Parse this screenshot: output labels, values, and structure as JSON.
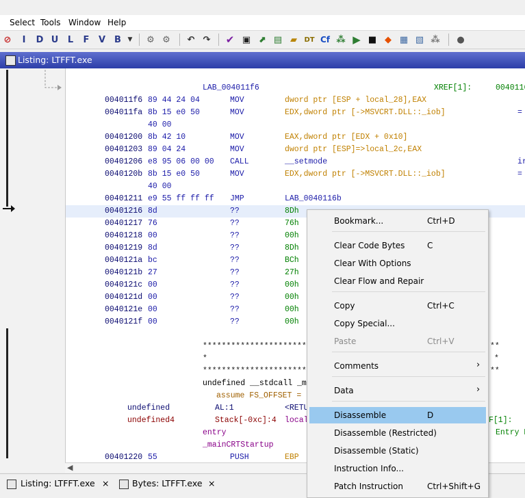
{
  "menu": [
    "Select",
    "Tools",
    "Window",
    "Help"
  ],
  "toolbar": {
    "letters": [
      "I",
      "D",
      "U",
      "L",
      "F",
      "V",
      "B"
    ]
  },
  "window_title": "Listing:  LTFFT.exe",
  "listing": {
    "label_line": {
      "label": "LAB_004011f6",
      "xref": "XREF[1]:",
      "xref_addr": "0040116"
    },
    "rows": [
      {
        "addr": "004011f6",
        "bytes": "89 44 24 04",
        "mn": "MOV",
        "op": "dword ptr [ESP + local_28],EAX",
        "extra": ""
      },
      {
        "addr": "004011fa",
        "bytes": "8b 15 e0 50",
        "mn": "MOV",
        "op": "EDX,dword ptr [->MSVCRT.DLL::_iob]",
        "extra": "="
      },
      {
        "addr": "",
        "bytes": "40 00",
        "mn": "",
        "op": "",
        "extra": ""
      },
      {
        "addr": "00401200",
        "bytes": "8b 42 10",
        "mn": "MOV",
        "op": "EAX,dword ptr [EDX + 0x10]",
        "extra": ""
      },
      {
        "addr": "00401203",
        "bytes": "89 04 24",
        "mn": "MOV",
        "op": "dword ptr [ESP]=>local_2c,EAX",
        "extra": ""
      },
      {
        "addr": "00401206",
        "bytes": "e8 95 06 00 00",
        "mn": "CALL",
        "op": "__setmode",
        "extra": "ir"
      },
      {
        "addr": "0040120b",
        "bytes": "8b 15 e0 50",
        "mn": "MOV",
        "op": "EDX,dword ptr [->MSVCRT.DLL::_iob]",
        "extra": "="
      },
      {
        "addr": "",
        "bytes": "40 00",
        "mn": "",
        "op": "",
        "extra": ""
      },
      {
        "addr": "00401211",
        "bytes": "e9 55 ff ff ff",
        "mn": "JMP",
        "op": "LAB_0040116b",
        "extra": ""
      },
      {
        "addr": "00401216",
        "bytes": "8d",
        "mn": "??",
        "op": "8Dh",
        "extra": ""
      },
      {
        "addr": "00401217",
        "bytes": "76",
        "mn": "??",
        "op": "76h",
        "extra": ""
      },
      {
        "addr": "00401218",
        "bytes": "00",
        "mn": "??",
        "op": "00h",
        "extra": ""
      },
      {
        "addr": "00401219",
        "bytes": "8d",
        "mn": "??",
        "op": "8Dh",
        "extra": ""
      },
      {
        "addr": "0040121a",
        "bytes": "bc",
        "mn": "??",
        "op": "BCh",
        "extra": ""
      },
      {
        "addr": "0040121b",
        "bytes": "27",
        "mn": "??",
        "op": "27h",
        "extra": ""
      },
      {
        "addr": "0040121c",
        "bytes": "00",
        "mn": "??",
        "op": "00h",
        "extra": ""
      },
      {
        "addr": "0040121d",
        "bytes": "00",
        "mn": "??",
        "op": "00h",
        "extra": ""
      },
      {
        "addr": "0040121e",
        "bytes": "00",
        "mn": "??",
        "op": "00h",
        "extra": ""
      },
      {
        "addr": "0040121f",
        "bytes": "00",
        "mn": "??",
        "op": "00h",
        "extra": ""
      }
    ],
    "stars_line": "*****************************************************",
    "star_single": "*",
    "stars_right_a": "**",
    "stars_right_b": "*",
    "stars_right_c": "**",
    "func_sig": "undefined __stdcall _m",
    "assume": "assume FS_OFFSET =",
    "vars": [
      {
        "type": "undefined",
        "loc": "AL:1",
        "name": "<RETU",
        "xref": ""
      },
      {
        "type": "undefined4",
        "loc": "Stack[-0xc]:4",
        "name": "local",
        "xref": "F[1]:"
      }
    ],
    "entry": "entry",
    "entry_xref": "Entry P",
    "main_label": "_mainCRTStartup",
    "last_row": {
      "addr": "00401220",
      "bytes": "55",
      "mn": "PUSH",
      "op": "EBP"
    }
  },
  "context_menu": [
    {
      "label": "Bookmark...",
      "shortcut": "Ctrl+D"
    },
    {
      "label": "Clear Code Bytes",
      "shortcut": "C"
    },
    {
      "label": "Clear With Options",
      "shortcut": ""
    },
    {
      "label": "Clear Flow and Repair",
      "shortcut": ""
    },
    {
      "label": "Copy",
      "shortcut": "Ctrl+C"
    },
    {
      "label": "Copy Special...",
      "shortcut": ""
    },
    {
      "label": "Paste",
      "shortcut": "Ctrl+V"
    },
    {
      "label": "Comments",
      "shortcut": ""
    },
    {
      "label": "Data",
      "shortcut": ""
    },
    {
      "label": "Disassemble",
      "shortcut": "D"
    },
    {
      "label": "Disassemble (Restricted)",
      "shortcut": ""
    },
    {
      "label": "Disassemble (Static)",
      "shortcut": ""
    },
    {
      "label": "Instruction Info...",
      "shortcut": ""
    },
    {
      "label": "Patch Instruction",
      "shortcut": "Ctrl+Shift+G"
    }
  ],
  "tabs": [
    {
      "label": "Listing:  LTFFT.exe",
      "close": "×"
    },
    {
      "label": "Bytes: LTFFT.exe",
      "close": "×"
    }
  ],
  "colors": {
    "title_bar": "#2c3ea8",
    "menu_selected": "#99c9ef"
  }
}
